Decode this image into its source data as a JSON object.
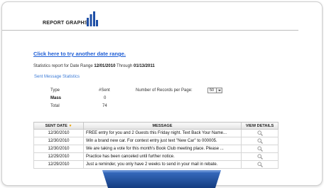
{
  "header": {
    "title": "REPORT GRAPHS"
  },
  "date_link": "Click here to try another date range.",
  "range": {
    "prefix": "Statistics report for Date Range ",
    "from": "12/01/2010",
    "through_word": " Through ",
    "to": "01/13/2011"
  },
  "stats": {
    "title": "Sent Message Statistics",
    "col_type": "Type",
    "col_sent": "#Sent",
    "records_label": "Number of Records per Page:",
    "records_value": "50",
    "rows": [
      {
        "type": "Mass",
        "sent": "0"
      },
      {
        "type": "Total",
        "sent": "74"
      }
    ]
  },
  "table": {
    "headers": {
      "date": "SENT DATE",
      "message": "MESSAGE",
      "view": "VIEW DETAILS"
    },
    "rows": [
      {
        "date": "12/30/2010",
        "message": "FREE entry for you and 2 Guests this Friday night. Text Back Your Name..."
      },
      {
        "date": "12/30/2010",
        "message": "Win a brand new car. For contest entry just text \"New Car\" to 000005."
      },
      {
        "date": "12/30/2010",
        "message": "We are taking a vote for this month's Book Club meeting place. Please ..."
      },
      {
        "date": "12/29/2010",
        "message": "Practice has been canceled until further notice."
      },
      {
        "date": "12/29/2010",
        "message": "Just a reminder, you only have 2 weeks to send in your mail in rebate."
      }
    ]
  },
  "colors": {
    "accent": "#1f5fd6",
    "tab": "#1e4f9e",
    "logo": "#1f4fa6"
  }
}
